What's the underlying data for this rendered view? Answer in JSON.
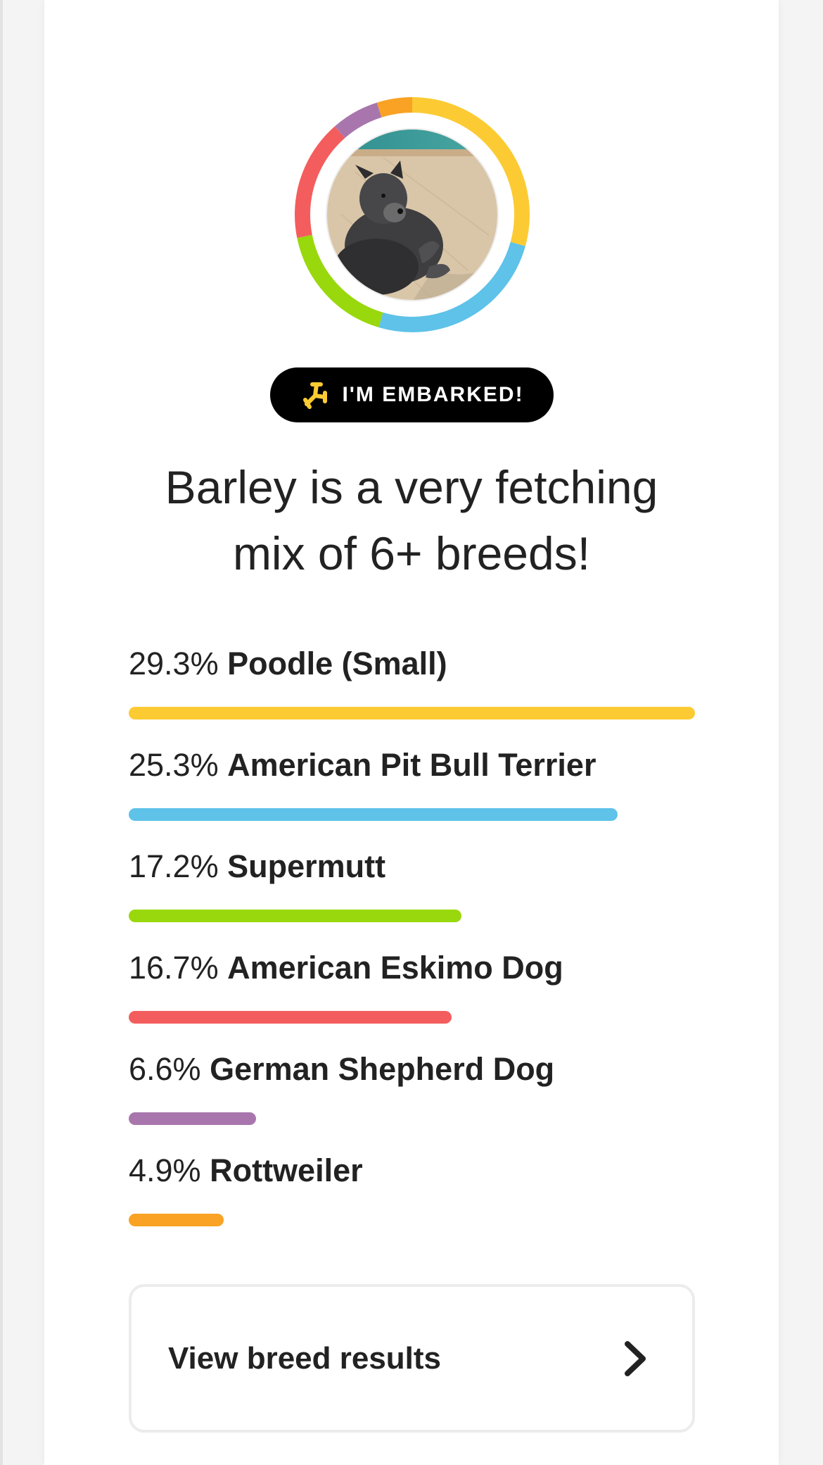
{
  "profile": {
    "badge_label": "I'M EMBARKED!",
    "headline_line1": "Barley is a very fetching",
    "headline_line2": "mix of 6+ breeds!"
  },
  "breeds": [
    {
      "percent": "29.3%",
      "name": "Poodle (Small)",
      "value": 29.3,
      "color": "#fccb33"
    },
    {
      "percent": "25.3%",
      "name": "American Pit Bull Terrier",
      "value": 25.3,
      "color": "#5ec2e9"
    },
    {
      "percent": "17.2%",
      "name": "Supermutt",
      "value": 17.2,
      "color": "#99d80c"
    },
    {
      "percent": "16.7%",
      "name": "American Eskimo Dog",
      "value": 16.7,
      "color": "#f45d5d"
    },
    {
      "percent": "6.6%",
      "name": "German Shepherd Dog",
      "value": 6.6,
      "color": "#a876ac"
    },
    {
      "percent": "4.9%",
      "name": "Rottweiler",
      "value": 4.9,
      "color": "#f9a224"
    }
  ],
  "actions": {
    "view_results_label": "View breed results"
  },
  "icons": {
    "badge": "dog-bone-icon",
    "chevron": "chevron-right-icon"
  }
}
